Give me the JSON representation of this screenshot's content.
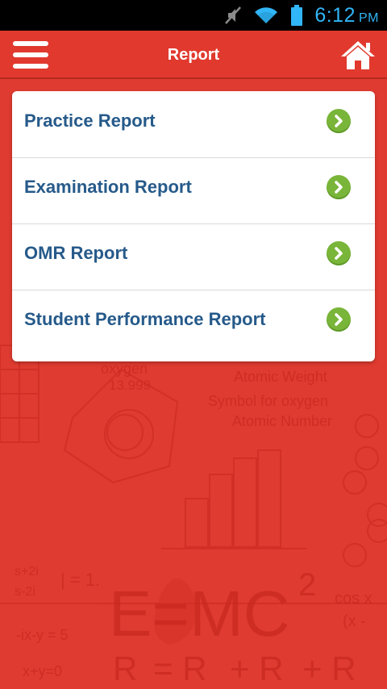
{
  "status_bar": {
    "time": "6:12",
    "ampm": "PM",
    "icons": [
      "mute-icon",
      "wifi-icon",
      "battery-icon"
    ]
  },
  "app_bar": {
    "title": "Report",
    "menu_icon": "hamburger-menu-icon",
    "home_icon": "home-icon"
  },
  "menu_items": [
    {
      "label": "Practice Report",
      "icon": "chevron-right-icon"
    },
    {
      "label": "Examination Report",
      "icon": "chevron-right-icon"
    },
    {
      "label": "OMR Report",
      "icon": "chevron-right-icon"
    },
    {
      "label": "Student Performance Report",
      "icon": "chevron-right-icon"
    }
  ],
  "background_text": {
    "oxygen": "oxygen",
    "mass": "13.999",
    "atomic_weight": "Atomic Weight",
    "symbol": "Symbol for oxygen",
    "atomic_number": "Atomic Number",
    "emc_e": "E=MC",
    "emc_exp": "2",
    "formula1": "R",
    "formula1_eq": "= R",
    "formula1_rest": "+ R",
    "formula1_end": "+ R",
    "left_frac": "s+2i",
    "left_frac_den": "s-2i",
    "left_eq": "| = 1.",
    "left_expr": "-ix-y = 5",
    "left_expr2": "x+y=0",
    "right_cos": "cos x",
    "right_expr": "(x -"
  },
  "colors": {
    "primary": "#e1392e",
    "link": "#265a8a",
    "accent_green": "#79b539",
    "status_blue": "#31b6f7"
  }
}
